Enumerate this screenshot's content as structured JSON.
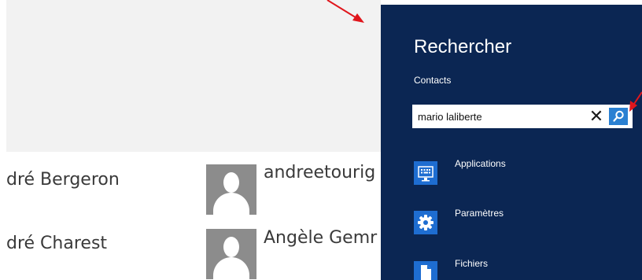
{
  "contacts_list": {
    "left_column": [
      {
        "name": "dré Bergeron"
      },
      {
        "name": "dré Charest"
      }
    ],
    "right_column": [
      {
        "name": "andreetourig"
      },
      {
        "name": "Angèle Gemr"
      }
    ]
  },
  "search_pane": {
    "title": "Rechercher",
    "scope": "Contacts",
    "query": "mario laliberte",
    "results": [
      {
        "label": "Applications",
        "icon": "keyboard-monitor-icon"
      },
      {
        "label": "Paramètres",
        "icon": "gear-icon"
      },
      {
        "label": "Fichiers",
        "icon": "document-icon"
      }
    ]
  },
  "colors": {
    "charm_background": "#0b2653",
    "accent_blue": "#2a80d2",
    "annotation_red": "#e0161c"
  }
}
